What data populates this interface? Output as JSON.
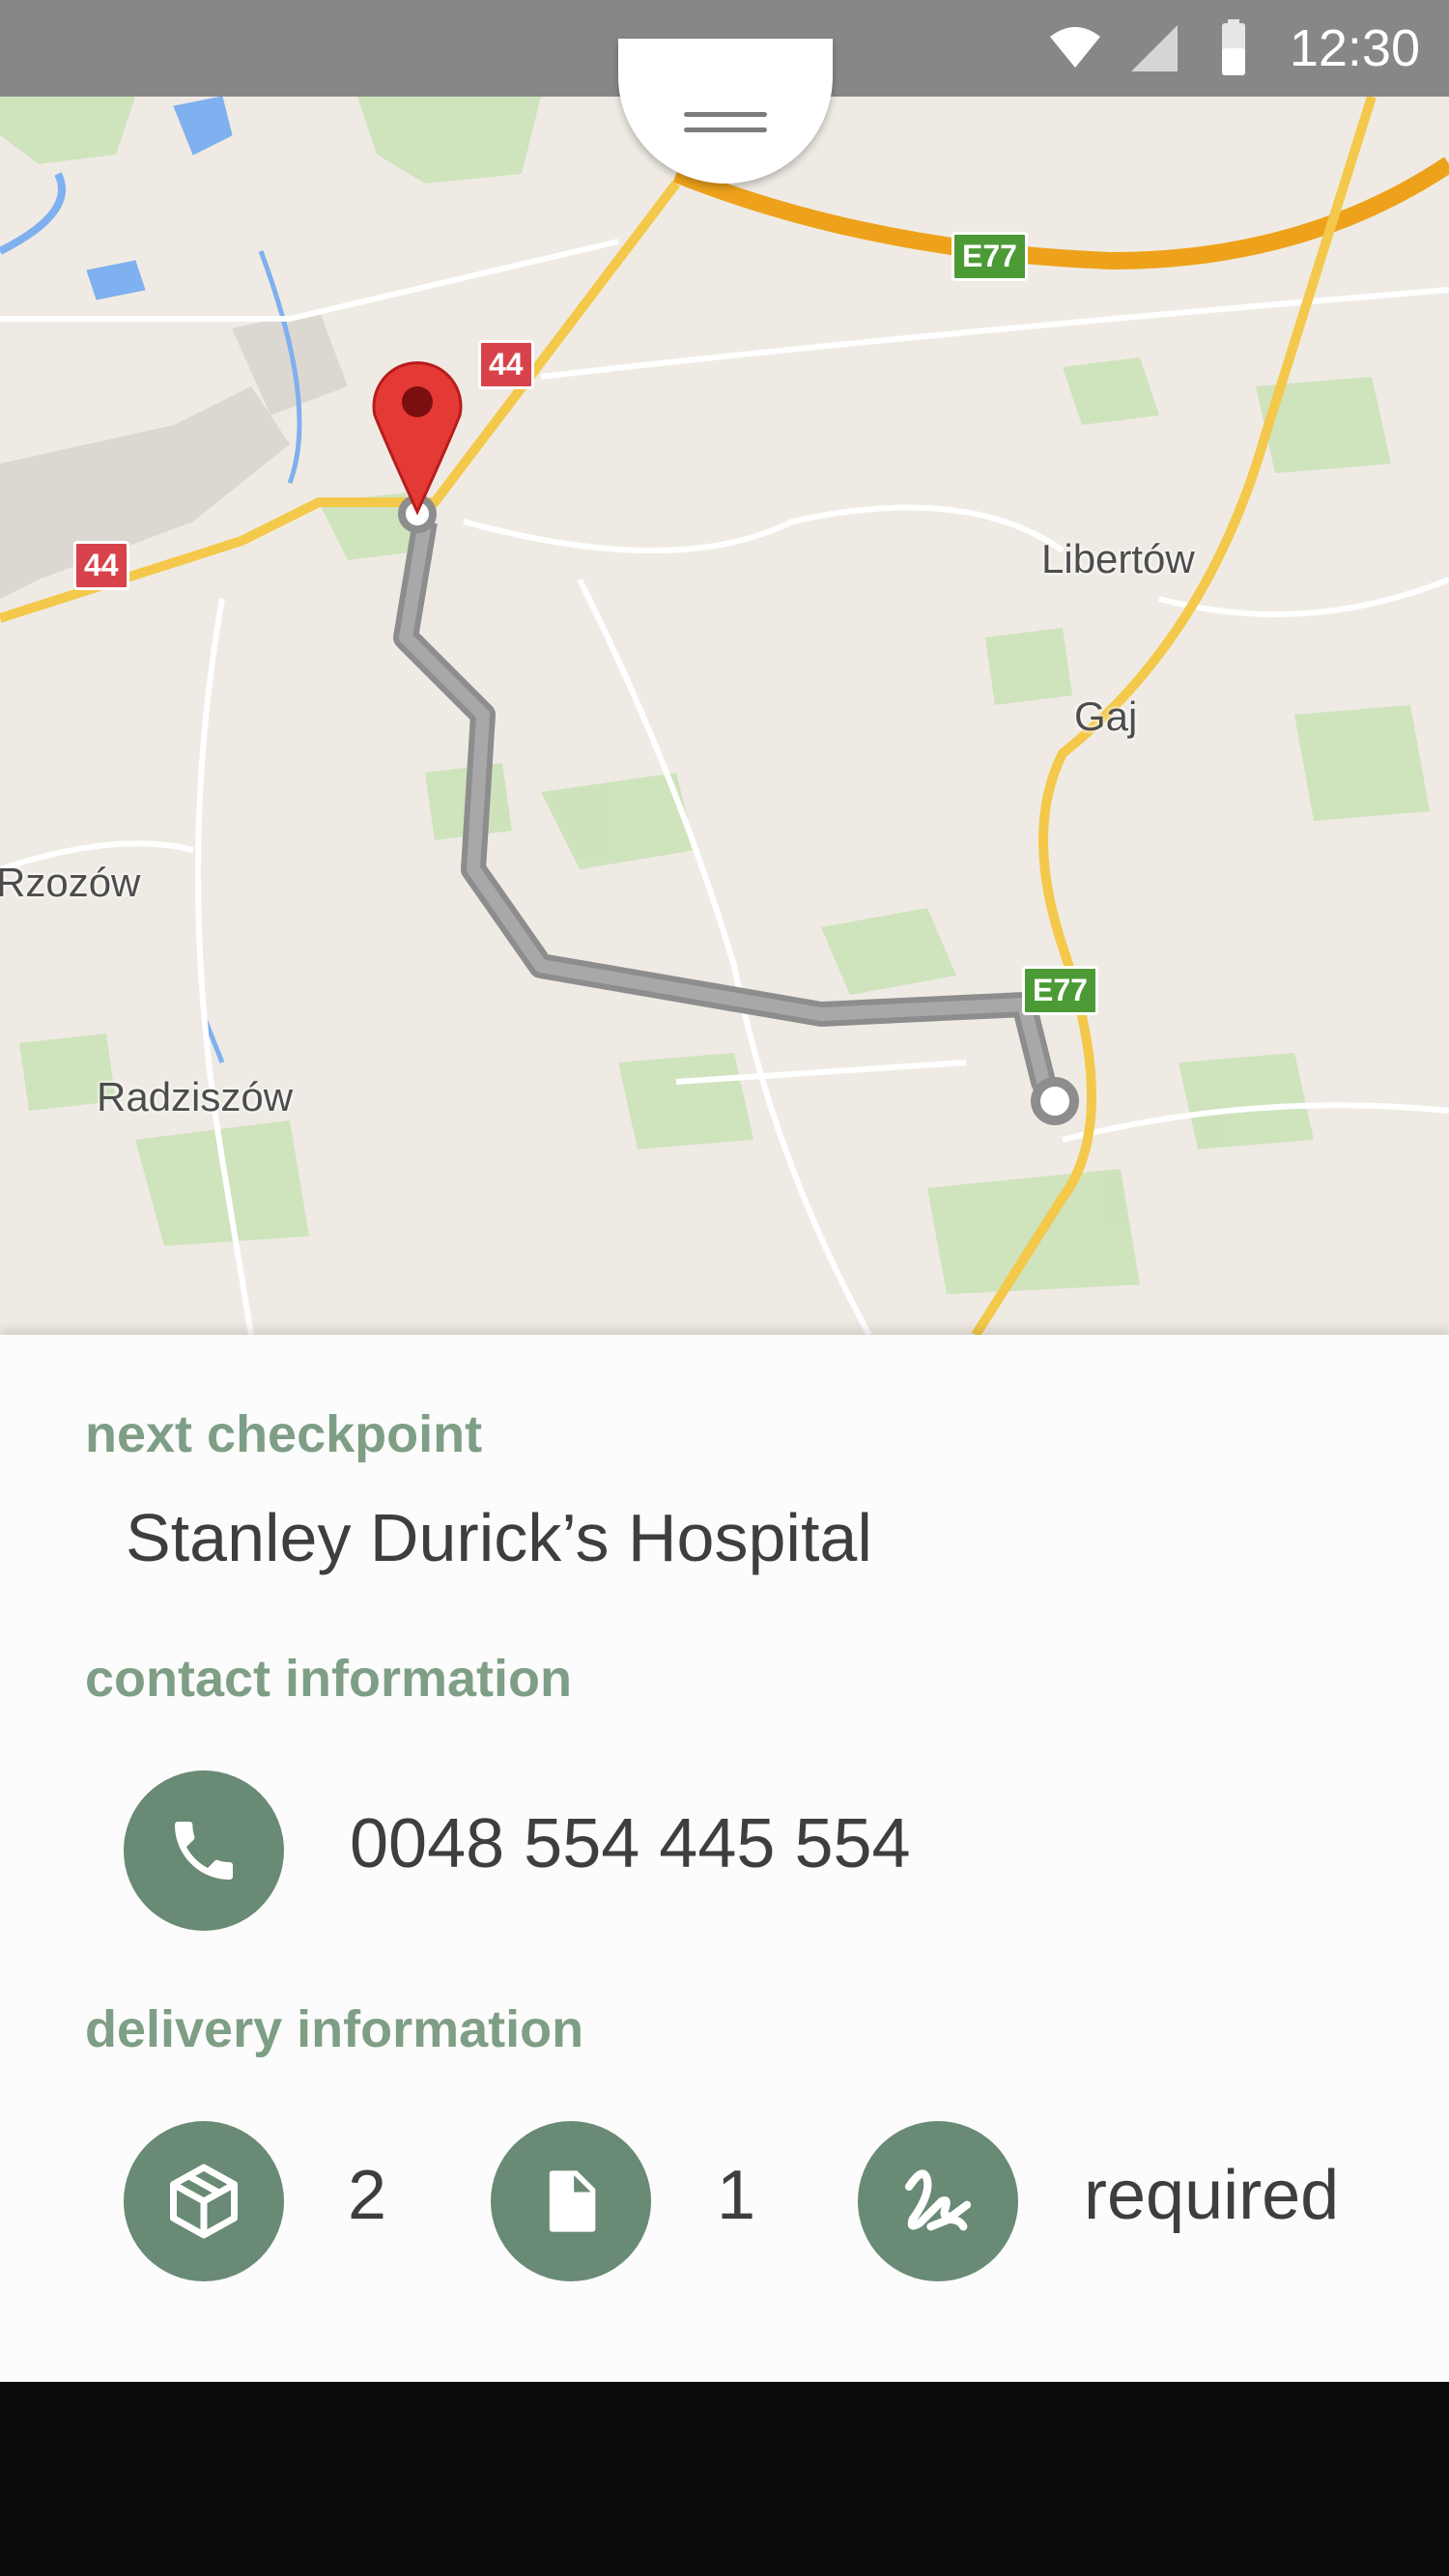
{
  "status_bar": {
    "time": "12:30",
    "icons": [
      "wifi-icon",
      "signal-icon",
      "battery-icon"
    ]
  },
  "map": {
    "place_labels": {
      "libertow": "Libertów",
      "gaj": "Gaj",
      "rzozow": "Rzozów",
      "radziszow": "Radziszów"
    },
    "road_shields": {
      "r44_top": "44",
      "r44_left": "44",
      "e77_top": "E77",
      "e77_right": "E77"
    },
    "icons": [
      "drawer-handle-icon",
      "destination-pin-icon"
    ]
  },
  "checkpoint": {
    "title": "next checkpoint",
    "name": "Stanley Durick’s Hospital"
  },
  "contact": {
    "title": "contact information",
    "phone": "0048 554 445 554"
  },
  "delivery": {
    "title": "delivery information",
    "packages": "2",
    "documents": "1",
    "signature": "required"
  },
  "colors": {
    "accent": "#698a74",
    "section_title": "#7e9e86",
    "status_bar": "#878787",
    "route": "#9a9a9a",
    "pin": "#e53935"
  }
}
